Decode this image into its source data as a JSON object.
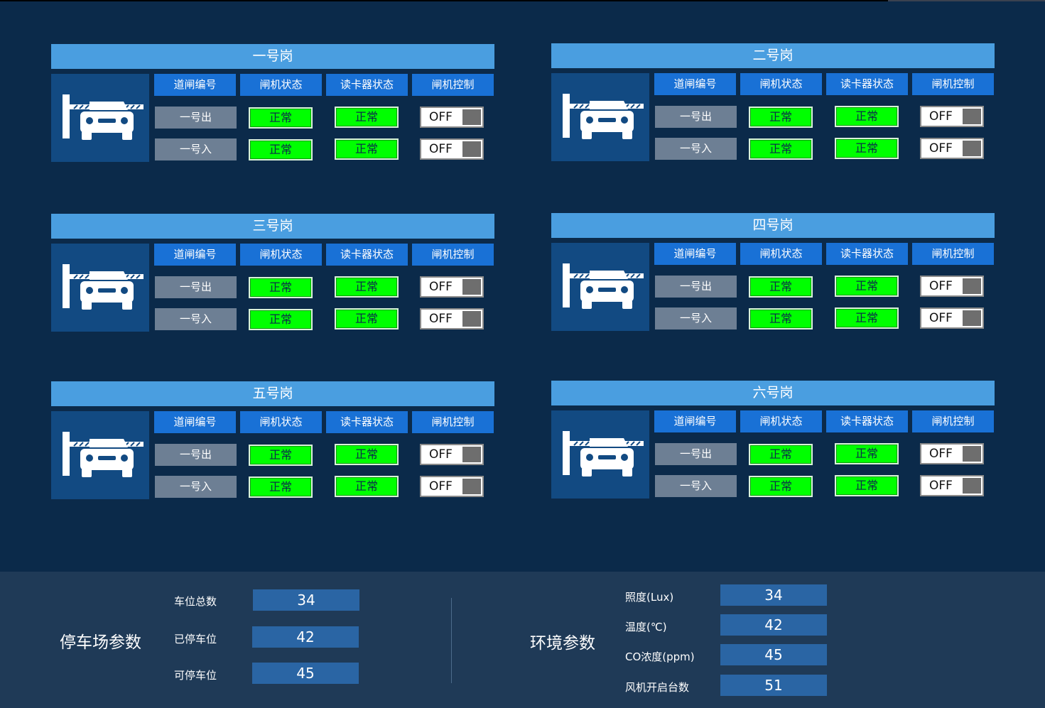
{
  "headers": {
    "gate_number": "道闸编号",
    "gate_status": "闸机状态",
    "reader_status": "读卡器状态",
    "gate_control": "闸机控制"
  },
  "stations": [
    {
      "title": "一号岗",
      "rows": [
        {
          "gate": "一号出",
          "gate_status": "正常",
          "reader_status": "正常",
          "control": "OFF"
        },
        {
          "gate": "一号入",
          "gate_status": "正常",
          "reader_status": "正常",
          "control": "OFF"
        }
      ]
    },
    {
      "title": "二号岗",
      "rows": [
        {
          "gate": "一号出",
          "gate_status": "正常",
          "reader_status": "正常",
          "control": "OFF"
        },
        {
          "gate": "一号入",
          "gate_status": "正常",
          "reader_status": "正常",
          "control": "OFF"
        }
      ]
    },
    {
      "title": "三号岗",
      "rows": [
        {
          "gate": "一号出",
          "gate_status": "正常",
          "reader_status": "正常",
          "control": "OFF"
        },
        {
          "gate": "一号入",
          "gate_status": "正常",
          "reader_status": "正常",
          "control": "OFF"
        }
      ]
    },
    {
      "title": "四号岗",
      "rows": [
        {
          "gate": "一号出",
          "gate_status": "正常",
          "reader_status": "正常",
          "control": "OFF"
        },
        {
          "gate": "一号入",
          "gate_status": "正常",
          "reader_status": "正常",
          "control": "OFF"
        }
      ]
    },
    {
      "title": "五号岗",
      "rows": [
        {
          "gate": "一号出",
          "gate_status": "正常",
          "reader_status": "正常",
          "control": "OFF"
        },
        {
          "gate": "一号入",
          "gate_status": "正常",
          "reader_status": "正常",
          "control": "OFF"
        }
      ]
    },
    {
      "title": "六号岗",
      "rows": [
        {
          "gate": "一号出",
          "gate_status": "正常",
          "reader_status": "正常",
          "control": "OFF"
        },
        {
          "gate": "一号入",
          "gate_status": "正常",
          "reader_status": "正常",
          "control": "OFF"
        }
      ]
    }
  ],
  "parking": {
    "title": "停车场参数",
    "params": [
      {
        "label": "车位总数",
        "value": "34"
      },
      {
        "label": "已停车位",
        "value": "42"
      },
      {
        "label": "可停车位",
        "value": "45"
      }
    ]
  },
  "environment": {
    "title": "环境参数",
    "params": [
      {
        "label": "照度(Lux)",
        "value": "34"
      },
      {
        "label": "温度(℃)",
        "value": "42"
      },
      {
        "label": "CO浓度(ppm)",
        "value": "45"
      },
      {
        "label": "风机开启台数",
        "value": "51"
      }
    ]
  },
  "colors": {
    "background": "#0b2a4a",
    "title_bar": "#4a9ee0",
    "header": "#1971d6",
    "status_ok": "#00ff00",
    "gate_id_bg": "#6d7f94"
  },
  "icons": {
    "gate": "parking-barrier-car-icon"
  }
}
